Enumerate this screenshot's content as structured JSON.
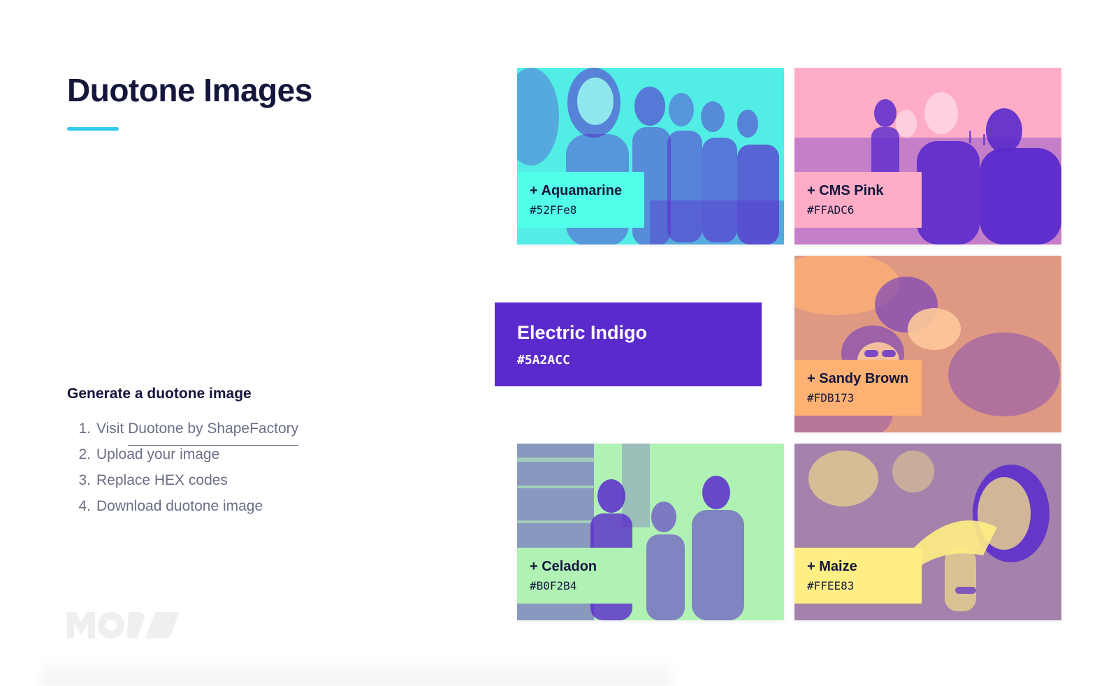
{
  "page": {
    "title": "Duotone Images",
    "accent_color": "#34C9F0"
  },
  "instructions": {
    "heading": "Generate a duotone image",
    "steps": [
      {
        "number": "1.",
        "prefix": "Visit ",
        "link_text": "Duotone by ShapeFactory"
      },
      {
        "number": "2.",
        "text": "Upload your image"
      },
      {
        "number": "3.",
        "text": "Replace HEX codes"
      },
      {
        "number": "4.",
        "text": "Download duotone image"
      }
    ]
  },
  "logo": {
    "text": "MOVV",
    "icon": "movv-logo-icon"
  },
  "base_color": {
    "name": "Electric Indigo",
    "hex": "#5A2ACC"
  },
  "swatches": [
    {
      "label": "+ Aquamarine",
      "hex": "#52FFe8",
      "color": "#52FFE8",
      "photo": "friends-laughing-bench"
    },
    {
      "label": "+ CMS Pink",
      "hex": "#FFADC6",
      "color": "#FFADC6",
      "photo": "friends-walking-field"
    },
    {
      "label": "+ Sandy Brown",
      "hex": "#FDB173",
      "color": "#FDB173",
      "photo": "friends-lying-grass"
    },
    {
      "label": "+ Celadon",
      "hex": "#B0F2B4",
      "color": "#B0F2B4",
      "photo": "friends-balcony-drinks"
    },
    {
      "label": "+ Maize",
      "hex": "#FFEE83",
      "color": "#FFEE83",
      "photo": "man-eating-pizza"
    }
  ]
}
